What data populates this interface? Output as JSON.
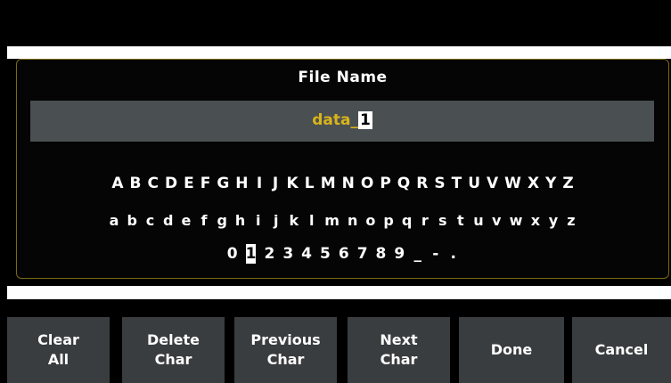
{
  "dialog": {
    "title": "File Name",
    "filename_prefix": "data_",
    "filename_cursor": "1"
  },
  "keyboard": {
    "row1": [
      "A",
      "B",
      "C",
      "D",
      "E",
      "F",
      "G",
      "H",
      "I",
      "J",
      "K",
      "L",
      "M",
      "N",
      "O",
      "P",
      "Q",
      "R",
      "S",
      "T",
      "U",
      "V",
      "W",
      "X",
      "Y",
      "Z"
    ],
    "row2": [
      "a",
      "b",
      "c",
      "d",
      "e",
      "f",
      "g",
      "h",
      "i",
      "j",
      "k",
      "l",
      "m",
      "n",
      "o",
      "p",
      "q",
      "r",
      "s",
      "t",
      "u",
      "v",
      "w",
      "x",
      "y",
      "z"
    ],
    "row3": [
      "0",
      "1",
      "2",
      "3",
      "4",
      "5",
      "6",
      "7",
      "8",
      "9",
      "_",
      "-",
      "."
    ],
    "selected_key": "1"
  },
  "softkeys": [
    {
      "label": "Clear\nAll"
    },
    {
      "label": "Delete\nChar"
    },
    {
      "label": "Previous\nChar"
    },
    {
      "label": "Next\nChar"
    },
    {
      "label": "Done"
    },
    {
      "label": "Cancel"
    }
  ],
  "colors": {
    "filename_text": "#d9b41a",
    "softkey_bg": "#3a3d3f",
    "filename_box_bg": "#4a4f52",
    "dialog_border": "#7a6a14"
  }
}
